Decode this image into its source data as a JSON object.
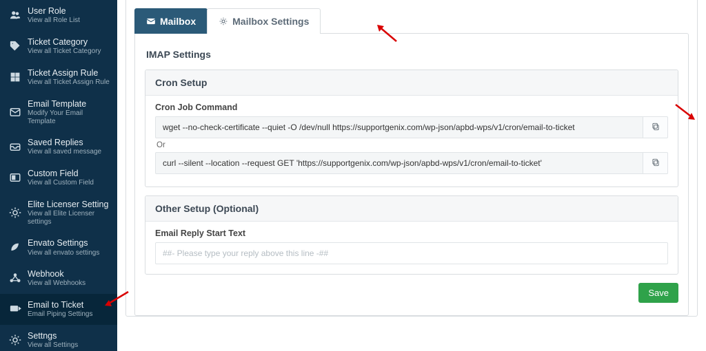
{
  "sidebar": {
    "items": [
      {
        "title": "User Role",
        "sub": "View all Role List",
        "icon": "users"
      },
      {
        "title": "Ticket Category",
        "sub": "View all Ticket Category",
        "icon": "tag"
      },
      {
        "title": "Ticket Assign Rule",
        "sub": "View all Ticket Assign Rule",
        "icon": "grid"
      },
      {
        "title": "Email Template",
        "sub": "Modify Your Email Template",
        "icon": "mail"
      },
      {
        "title": "Saved Replies",
        "sub": "View all saved message",
        "icon": "inbox"
      },
      {
        "title": "Custom Field",
        "sub": "View all Custom Field",
        "icon": "layout"
      },
      {
        "title": "Elite Licenser Setting",
        "sub": "View all Elite Licenser settings",
        "icon": "gear"
      },
      {
        "title": "Envato Settings",
        "sub": "View all envato settings",
        "icon": "leaf"
      },
      {
        "title": "Webhook",
        "sub": "View all Webhooks",
        "icon": "hook"
      },
      {
        "title": "Email to Ticket",
        "sub": "Email Piping Settings",
        "icon": "forward",
        "active": true
      },
      {
        "title": "Settngs",
        "sub": "View all Settings",
        "icon": "gear"
      }
    ]
  },
  "tabs": {
    "mailbox": "Mailbox",
    "settings": "Mailbox Settings"
  },
  "imap_heading": "IMAP Settings",
  "cron": {
    "heading": "Cron Setup",
    "label": "Cron Job Command",
    "cmd1": "wget --no-check-certificate --quiet -O /dev/null https://supportgenix.com/wp-json/apbd-wps/v1/cron/email-to-ticket",
    "or": "Or",
    "cmd2": "curl --silent --location --request GET 'https://supportgenix.com/wp-json/apbd-wps/v1/cron/email-to-ticket'"
  },
  "other": {
    "heading": "Other Setup (Optional)",
    "label": "Email Reply Start Text",
    "placeholder": "##- Please type your reply above this line -##"
  },
  "save_label": "Save"
}
